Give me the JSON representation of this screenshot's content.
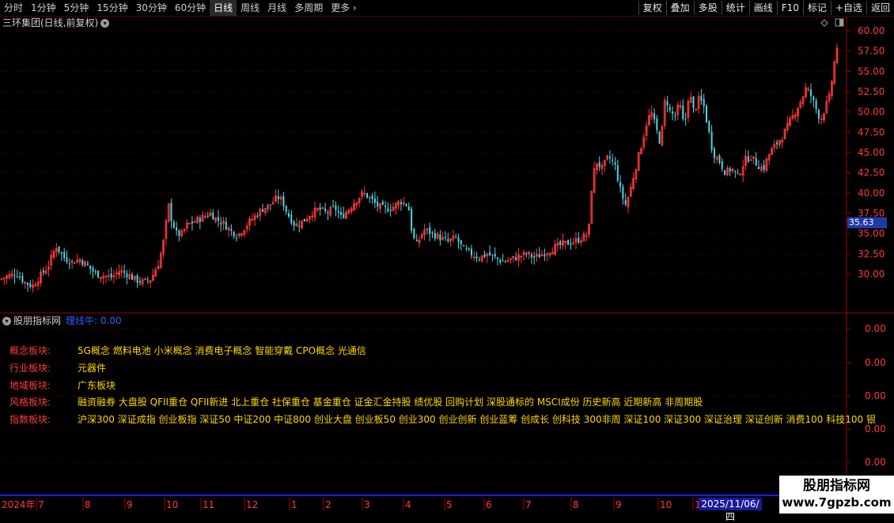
{
  "toolbar": {
    "periods": [
      "分时",
      "1分钟",
      "5分钟",
      "15分钟",
      "30分钟",
      "60分钟",
      "日线",
      "周线",
      "月线",
      "多周期",
      "更多"
    ],
    "active_period": "日线",
    "more_arrow": "›",
    "buttons": [
      "复权",
      "叠加",
      "多股",
      "统计",
      "画线",
      "F10",
      "标记",
      "+自选",
      "返回"
    ]
  },
  "chart_title": "三环集团(日线,前复权)",
  "right_icons": [
    "diamond-icon",
    "window-icon"
  ],
  "price_axis": {
    "labels": [
      "60.00",
      "57.50",
      "55.00",
      "52.50",
      "50.00",
      "47.50",
      "45.00",
      "42.50",
      "40.00",
      "37.50",
      "35.00",
      "32.50",
      "30.00"
    ],
    "current_price": "35.63"
  },
  "sub_panel": {
    "name": "股朋指标网",
    "indicator": "理线牛: 0.00",
    "axis_labels": [
      "0.00",
      "0.00",
      "0.00",
      "0.00",
      "0.00"
    ],
    "rows": [
      {
        "label": "概念板块:",
        "value": "5G概念 燃料电池 小米概念 消费电子概念 智能穿戴 CPO概念 光通信"
      },
      {
        "label": "行业板块:",
        "value": "元器件"
      },
      {
        "label": "地域板块:",
        "value": "广东板块"
      },
      {
        "label": "风格板块:",
        "value": "融资融券 大盘股 QFII重仓 QFII新进 北上重仓 社保重仓 基金重仓 证金汇金持股 绩优股 回购计划 深股通标的 MSCI成份 历史新高 近期新高 非周期股"
      },
      {
        "label": "指数板块:",
        "value": "沪深300 深证成指 创业板指 深证50 中证200 中证800 创业大盘 创业板50 创业300 创业创新 创业蓝筹 创成长 创科技 300非周 深证100 深证300 深证治理 深证创新 消费100 科技100 银"
      }
    ]
  },
  "time_axis": {
    "year_label": "2024年",
    "months": [
      "7",
      "8",
      "9",
      "10",
      "11",
      "12",
      "1",
      "2",
      "3",
      "4",
      "5",
      "6",
      "7",
      "8",
      "9",
      "10",
      "1"
    ],
    "date_badge": "2025/11/06/四"
  },
  "watermark": {
    "line1": "股朋指标网",
    "line2": "www.7gpzb.com"
  },
  "price_series": {
    "y_range": [
      27,
      61
    ],
    "key_closes": [
      [
        0,
        29.4
      ],
      [
        10,
        29.8
      ],
      [
        20,
        30.1
      ],
      [
        30,
        29.0
      ],
      [
        40,
        28.5
      ],
      [
        50,
        29.8
      ],
      [
        60,
        31.0
      ],
      [
        70,
        33.5
      ],
      [
        80,
        32.0
      ],
      [
        90,
        31.5
      ],
      [
        100,
        31.8
      ],
      [
        110,
        31.0
      ],
      [
        120,
        30.0
      ],
      [
        130,
        29.8
      ],
      [
        140,
        29.6
      ],
      [
        150,
        30.4
      ],
      [
        160,
        30.0
      ],
      [
        170,
        29.3
      ],
      [
        180,
        29.0
      ],
      [
        190,
        29.4
      ],
      [
        200,
        31.5
      ],
      [
        208,
        35.0
      ],
      [
        211,
        39.0
      ],
      [
        215,
        37.0
      ],
      [
        222,
        35.0
      ],
      [
        228,
        34.8
      ],
      [
        235,
        36.0
      ],
      [
        245,
        36.5
      ],
      [
        255,
        37.0
      ],
      [
        265,
        37.5
      ],
      [
        272,
        36.8
      ],
      [
        282,
        36.2
      ],
      [
        292,
        35.2
      ],
      [
        300,
        34.8
      ],
      [
        310,
        36.0
      ],
      [
        320,
        37.0
      ],
      [
        330,
        38.0
      ],
      [
        340,
        38.5
      ],
      [
        350,
        39.5
      ],
      [
        356,
        39.0
      ],
      [
        362,
        37.5
      ],
      [
        372,
        36.0
      ],
      [
        382,
        36.5
      ],
      [
        392,
        37.5
      ],
      [
        402,
        38.0
      ],
      [
        412,
        37.5
      ],
      [
        422,
        38.2
      ],
      [
        430,
        37.0
      ],
      [
        438,
        37.8
      ],
      [
        448,
        39.0
      ],
      [
        458,
        40.0
      ],
      [
        465,
        39.5
      ],
      [
        475,
        38.5
      ],
      [
        485,
        38.0
      ],
      [
        495,
        38.2
      ],
      [
        505,
        39.0
      ],
      [
        515,
        38.5
      ],
      [
        520,
        35.0
      ],
      [
        525,
        33.5
      ],
      [
        535,
        35.5
      ],
      [
        545,
        35.0
      ],
      [
        555,
        34.5
      ],
      [
        565,
        34.0
      ],
      [
        575,
        34.5
      ],
      [
        585,
        33.0
      ],
      [
        595,
        32.5
      ],
      [
        605,
        32.0
      ],
      [
        615,
        32.5
      ],
      [
        625,
        32.0
      ],
      [
        635,
        31.5
      ],
      [
        645,
        31.8
      ],
      [
        655,
        32.2
      ],
      [
        665,
        32.5
      ],
      [
        675,
        32.0
      ],
      [
        685,
        32.5
      ],
      [
        695,
        33.0
      ],
      [
        705,
        33.5
      ],
      [
        715,
        33.8
      ],
      [
        725,
        34.0
      ],
      [
        735,
        34.5
      ],
      [
        743,
        35.0
      ],
      [
        746,
        40.0
      ],
      [
        752,
        44.0
      ],
      [
        760,
        43.0
      ],
      [
        768,
        44.5
      ],
      [
        776,
        43.5
      ],
      [
        784,
        40.0
      ],
      [
        790,
        38.5
      ],
      [
        796,
        40.5
      ],
      [
        802,
        43.0
      ],
      [
        810,
        46.0
      ],
      [
        816,
        48.5
      ],
      [
        822,
        50.0
      ],
      [
        828,
        48.0
      ],
      [
        834,
        46.0
      ],
      [
        840,
        52.0
      ],
      [
        846,
        50.0
      ],
      [
        852,
        49.5
      ],
      [
        858,
        51.0
      ],
      [
        864,
        48.0
      ],
      [
        870,
        52.5
      ],
      [
        876,
        50.0
      ],
      [
        882,
        51.5
      ],
      [
        888,
        51.0
      ],
      [
        894,
        48.0
      ],
      [
        900,
        45.0
      ],
      [
        908,
        44.0
      ],
      [
        916,
        42.5
      ],
      [
        924,
        43.0
      ],
      [
        932,
        42.0
      ],
      [
        940,
        44.0
      ],
      [
        948,
        44.5
      ],
      [
        956,
        43.5
      ],
      [
        964,
        43.0
      ],
      [
        972,
        45.0
      ],
      [
        980,
        46.0
      ],
      [
        988,
        47.0
      ],
      [
        996,
        48.5
      ],
      [
        1004,
        50.0
      ],
      [
        1012,
        51.5
      ],
      [
        1018,
        53.0
      ],
      [
        1024,
        52.0
      ],
      [
        1030,
        50.5
      ],
      [
        1036,
        49.0
      ],
      [
        1042,
        50.5
      ],
      [
        1048,
        52.0
      ],
      [
        1052,
        55.0
      ],
      [
        1056,
        57.5
      ],
      [
        1060,
        59.5
      ]
    ]
  }
}
